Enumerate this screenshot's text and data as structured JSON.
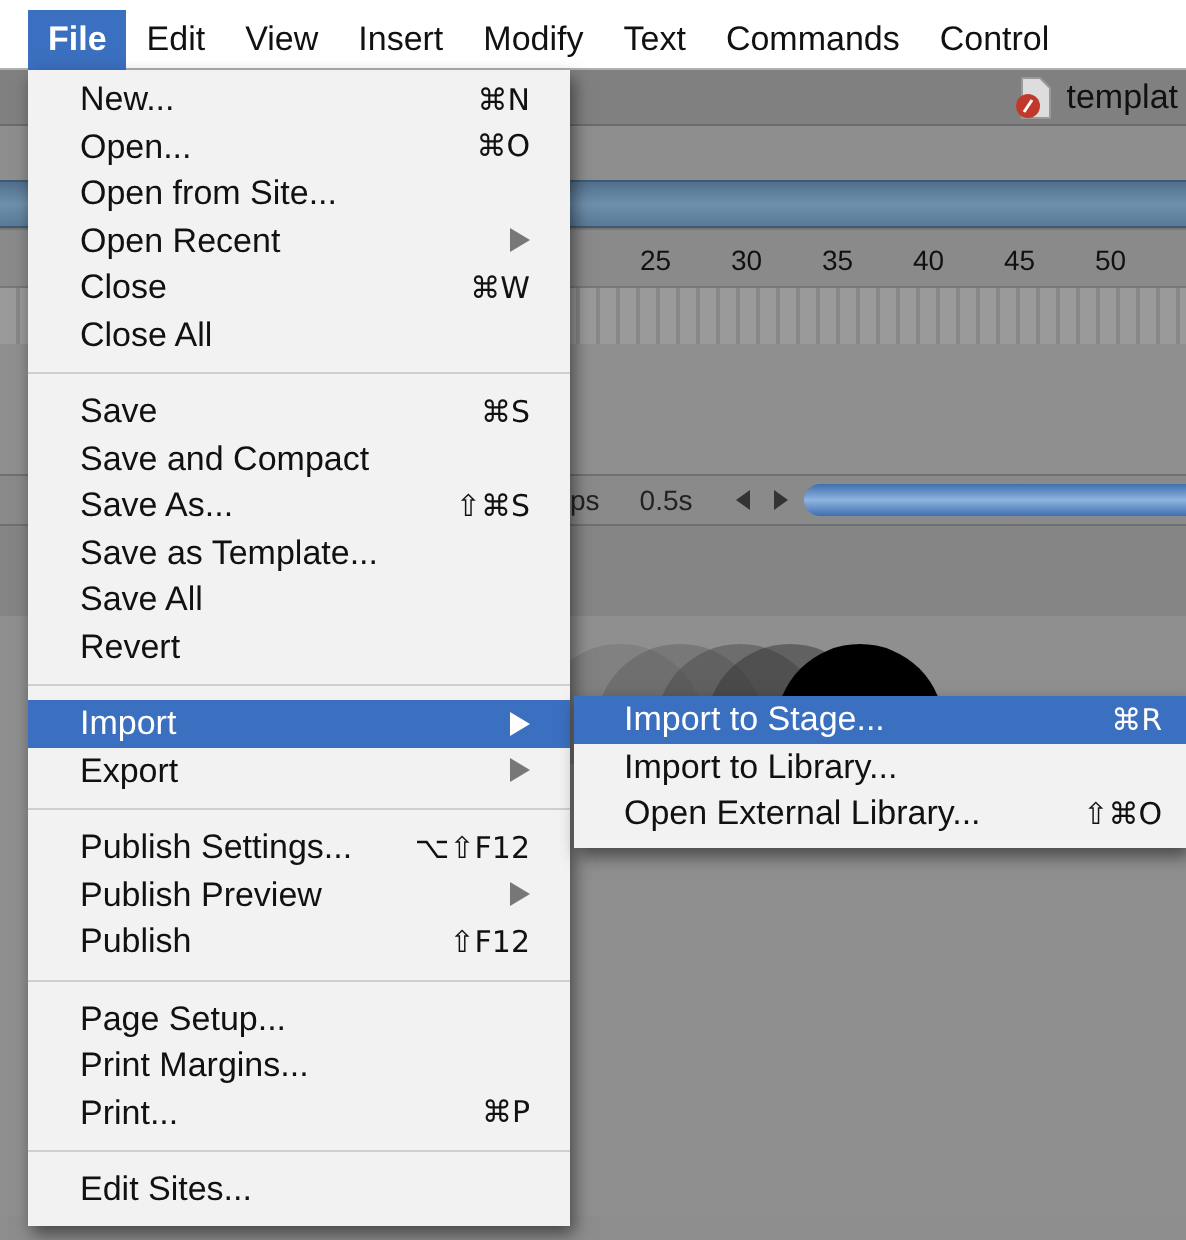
{
  "menubar": [
    {
      "label": "File",
      "selected": true
    },
    {
      "label": "Edit",
      "selected": false
    },
    {
      "label": "View",
      "selected": false
    },
    {
      "label": "Insert",
      "selected": false
    },
    {
      "label": "Modify",
      "selected": false
    },
    {
      "label": "Text",
      "selected": false
    },
    {
      "label": "Commands",
      "selected": false
    },
    {
      "label": "Control",
      "selected": false
    }
  ],
  "document_tab": {
    "title": "templat"
  },
  "timeline": {
    "ruler_labels": [
      "25",
      "30",
      "35",
      "40",
      "45",
      "50"
    ],
    "frame_rate": "ps",
    "elapsed": "0.5s"
  },
  "file_menu": [
    [
      {
        "label": "New...",
        "shortcut": "⌘N",
        "submenu": false,
        "selected": false
      },
      {
        "label": "Open...",
        "shortcut": "⌘O",
        "submenu": false,
        "selected": false
      },
      {
        "label": "Open from Site...",
        "submenu": false,
        "selected": false
      },
      {
        "label": "Open Recent",
        "submenu": true,
        "selected": false
      },
      {
        "label": "Close",
        "shortcut": "⌘W",
        "submenu": false,
        "selected": false
      },
      {
        "label": "Close All",
        "submenu": false,
        "selected": false
      }
    ],
    [
      {
        "label": "Save",
        "shortcut": "⌘S",
        "submenu": false,
        "selected": false
      },
      {
        "label": "Save and Compact",
        "submenu": false,
        "selected": false
      },
      {
        "label": "Save As...",
        "shortcut": "⇧⌘S",
        "submenu": false,
        "selected": false
      },
      {
        "label": "Save as Template...",
        "submenu": false,
        "selected": false
      },
      {
        "label": "Save All",
        "submenu": false,
        "selected": false
      },
      {
        "label": "Revert",
        "submenu": false,
        "selected": false
      }
    ],
    [
      {
        "label": "Import",
        "submenu": true,
        "selected": true
      },
      {
        "label": "Export",
        "submenu": true,
        "selected": false
      }
    ],
    [
      {
        "label": "Publish Settings...",
        "shortcut": "⌥⇧F12",
        "submenu": false,
        "selected": false
      },
      {
        "label": "Publish Preview",
        "submenu": true,
        "selected": false
      },
      {
        "label": "Publish",
        "shortcut": "⇧F12",
        "submenu": false,
        "selected": false
      }
    ],
    [
      {
        "label": "Page Setup...",
        "submenu": false,
        "selected": false
      },
      {
        "label": "Print Margins...",
        "submenu": false,
        "selected": false
      },
      {
        "label": "Print...",
        "shortcut": "⌘P",
        "submenu": false,
        "selected": false
      }
    ],
    [
      {
        "label": "Edit Sites...",
        "submenu": false,
        "selected": false
      }
    ]
  ],
  "import_submenu": [
    {
      "label": "Import to Stage...",
      "shortcut": "⌘R",
      "selected": true
    },
    {
      "label": "Import to Library...",
      "selected": false
    },
    {
      "label": "Open External Library...",
      "shortcut": "⇧⌘O",
      "selected": false
    }
  ]
}
